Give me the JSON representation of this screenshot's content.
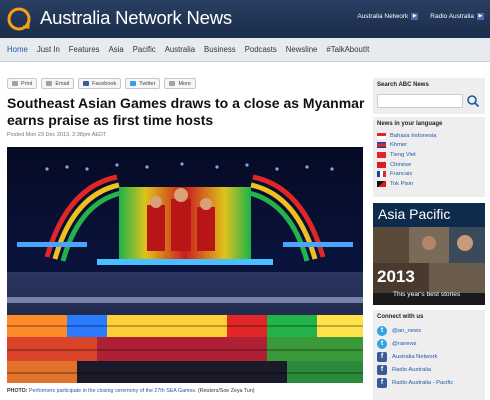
{
  "header": {
    "site_title": "Australia Network News",
    "top_links": [
      "Australia Network",
      "Radio Australia"
    ]
  },
  "nav": {
    "items": [
      "Home",
      "Just In",
      "Features",
      "Asia",
      "Pacific",
      "Australia",
      "Business",
      "Podcasts",
      "Newsline",
      "#TalkAboutIt"
    ]
  },
  "share": {
    "buttons": [
      "Print",
      "Email",
      "Facebook",
      "Twitter",
      "More"
    ]
  },
  "article": {
    "headline": "Southeast Asian Games draws to a close as Myanmar earns praise as first time hosts",
    "dateline": "Posted Mon 23 Dec 2013, 2:38pm AEDT",
    "caption_label": "PHOTO:",
    "caption_text": "Performers participate in the closing ceremony of the 27th SEA Games.",
    "caption_credit": "(Reuters/Soe Zeya Tun)"
  },
  "sidebar": {
    "search_title": "Search ABC News",
    "search_placeholder": "",
    "languages_title": "News in your language",
    "languages": [
      "Bahasa Indonesia",
      "Khmer",
      "Tieng Viet",
      "Chinese",
      "Francais",
      "Tok Pisin"
    ],
    "promo_title": "Asia Pacific",
    "promo_year": "2013",
    "promo_sub": "This year's best stories",
    "connect_title": "Connect with us",
    "social": [
      {
        "type": "twitter",
        "label": "@an_news"
      },
      {
        "type": "twitter",
        "label": "@ranews"
      },
      {
        "type": "facebook",
        "label": "Australia Network"
      },
      {
        "type": "facebook",
        "label": "Radio Australia"
      },
      {
        "type": "facebook",
        "label": "Radio Australia - Pacific"
      }
    ]
  },
  "colors": {
    "header_bg": "#1b2c4a",
    "link_blue": "#1f5aa6",
    "logo_orange": "#f5a21a"
  }
}
